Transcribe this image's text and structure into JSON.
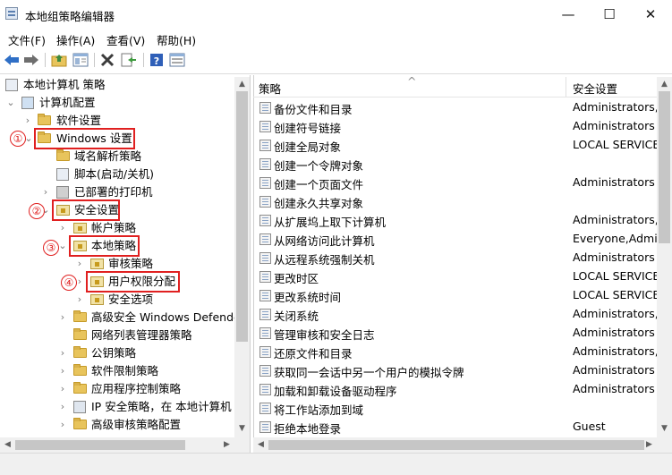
{
  "window": {
    "title": "本地组策略编辑器",
    "min_glyph": "—",
    "max_glyph": "☐",
    "close_glyph": "✕"
  },
  "menu": [
    "文件(F)",
    "操作(A)",
    "查看(V)",
    "帮助(H)"
  ],
  "toolbar": [
    "back-icon",
    "forward-icon",
    "up-folder-icon",
    "show-hide-tree-icon",
    "delete-icon",
    "export-list-icon",
    "help-icon",
    "properties-icon"
  ],
  "tree": {
    "root": "本地计算机 策略",
    "computer_config": "计算机配置",
    "software_settings": "软件设置",
    "windows_settings": "Windows 设置",
    "dns": "域名解析策略",
    "scripts": "脚本(启动/关机)",
    "printers": "已部署的打印机",
    "security_settings": "安全设置",
    "account_policies": "帐户策略",
    "local_policies": "本地策略",
    "audit_policy": "审核策略",
    "user_rights": "用户权限分配",
    "security_options": "安全选项",
    "advanced_firewall": "高级安全 Windows Defende",
    "network_list": "网络列表管理器策略",
    "public_key": "公钥策略",
    "software_restriction": "软件限制策略",
    "app_control": "应用程序控制策略",
    "ipsec": "IP 安全策略，在 本地计算机",
    "advanced_audit": "高级审核策略配置"
  },
  "annotations": [
    "①",
    "②",
    "③",
    "④"
  ],
  "list": {
    "columns": [
      "策略",
      "安全设置"
    ],
    "sort_glyph": "^",
    "rows": [
      {
        "name": "备份文件和目录",
        "setting": "Administrators,E"
      },
      {
        "name": "创建符号链接",
        "setting": "Administrators"
      },
      {
        "name": "创建全局对象",
        "setting": "LOCAL SERVICE,"
      },
      {
        "name": "创建一个令牌对象",
        "setting": ""
      },
      {
        "name": "创建一个页面文件",
        "setting": "Administrators"
      },
      {
        "name": "创建永久共享对象",
        "setting": ""
      },
      {
        "name": "从扩展坞上取下计算机",
        "setting": "Administrators,U"
      },
      {
        "name": "从网络访问此计算机",
        "setting": "Everyone,Admin"
      },
      {
        "name": "从远程系统强制关机",
        "setting": "Administrators"
      },
      {
        "name": "更改时区",
        "setting": "LOCAL SERVICE,"
      },
      {
        "name": "更改系统时间",
        "setting": "LOCAL SERVICE,"
      },
      {
        "name": "关闭系统",
        "setting": "Administrators,U"
      },
      {
        "name": "管理审核和安全日志",
        "setting": "Administrators"
      },
      {
        "name": "还原文件和目录",
        "setting": "Administrators,E"
      },
      {
        "name": "获取同一会话中另一个用户的模拟令牌",
        "setting": "Administrators"
      },
      {
        "name": "加载和卸载设备驱动程序",
        "setting": "Administrators"
      },
      {
        "name": "将工作站添加到域",
        "setting": ""
      },
      {
        "name": "拒绝本地登录",
        "setting": "Guest"
      }
    ]
  },
  "colors": {
    "highlight": "#e02020",
    "folder": "#e8c45c",
    "accent_blue": "#2f6fc6"
  }
}
